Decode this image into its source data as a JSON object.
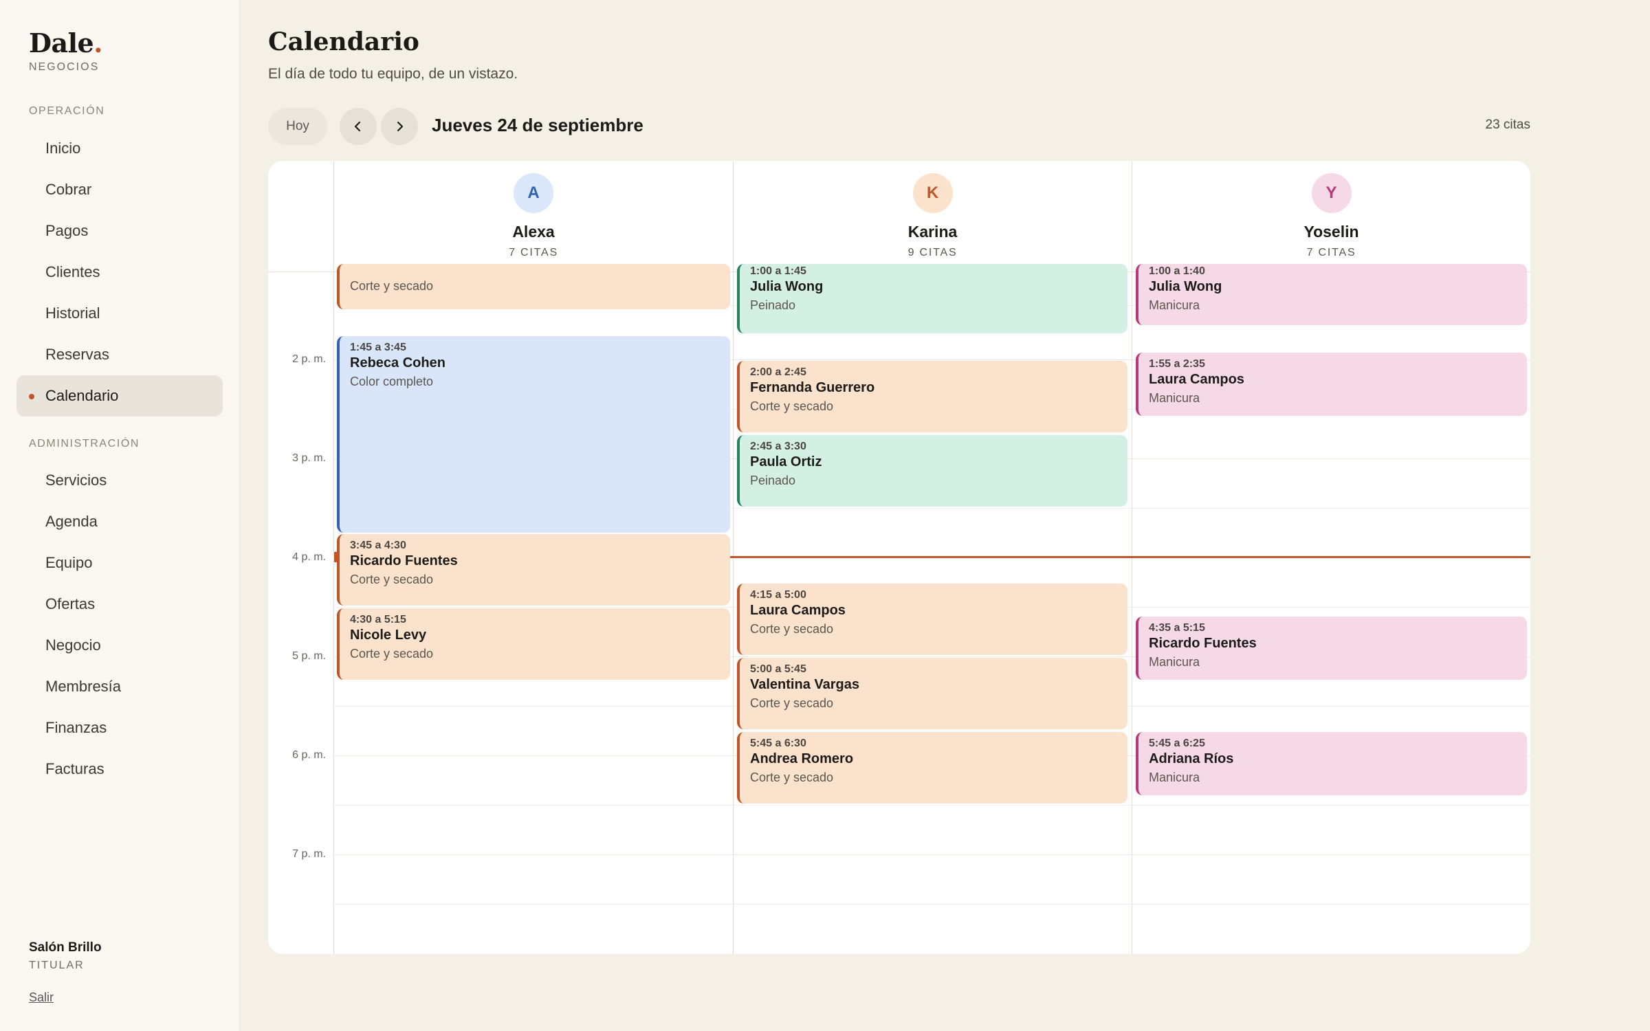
{
  "brand": {
    "name": "Dale",
    "dot": ".",
    "subtitle": "NEGOCIOS"
  },
  "sidebar": {
    "section_operacion": "OPERACIÓN",
    "section_admin": "ADMINISTRACIÓN",
    "operacion_items": [
      {
        "label": "Inicio"
      },
      {
        "label": "Cobrar"
      },
      {
        "label": "Pagos"
      },
      {
        "label": "Clientes"
      },
      {
        "label": "Historial"
      },
      {
        "label": "Reservas"
      },
      {
        "label": "Calendario",
        "active": true
      }
    ],
    "admin_items": [
      {
        "label": "Servicios"
      },
      {
        "label": "Agenda"
      },
      {
        "label": "Equipo"
      },
      {
        "label": "Ofertas"
      },
      {
        "label": "Negocio"
      },
      {
        "label": "Membresía"
      },
      {
        "label": "Finanzas"
      },
      {
        "label": "Facturas"
      }
    ],
    "owner_name": "Salón Brillo",
    "owner_role": "TITULAR",
    "logout": "Salir"
  },
  "page": {
    "title": "Calendario",
    "subtitle": "El día de todo tu equipo, de un vistazo."
  },
  "toolbar": {
    "today": "Hoy",
    "prev_icon": "chevron-left-icon",
    "next_icon": "chevron-right-icon",
    "date": "Jueves 24 de septiembre",
    "count": "23 citas"
  },
  "calendar": {
    "hours": [
      "2 p. m.",
      "3 p. m.",
      "4 p. m.",
      "5 p. m.",
      "6 p. m.",
      "7 p. m."
    ],
    "staff": [
      {
        "initial": "A",
        "name": "Alexa",
        "count": "7 CITAS",
        "avatar_bg": "#dbe7fb",
        "avatar_fg": "#2f62b4",
        "appointments": [
          {
            "time": "",
            "client": "",
            "service": "Corte y secado",
            "color": "orange",
            "cut": true
          },
          {
            "time": "1:45 a 3:45",
            "client": "Rebeca Cohen",
            "service": "Color completo",
            "color": "blue"
          },
          {
            "time": "3:45 a 4:30",
            "client": "Ricardo Fuentes",
            "service": "Corte y secado",
            "color": "orange"
          },
          {
            "time": "4:30 a 5:15",
            "client": "Nicole Levy",
            "service": "Corte y secado",
            "color": "orange"
          }
        ]
      },
      {
        "initial": "K",
        "name": "Karina",
        "count": "9 CITAS",
        "avatar_bg": "#fbe2cc",
        "avatar_fg": "#c0552a",
        "appointments": [
          {
            "time": "1:00 a 1:45",
            "client": "Julia Wong",
            "service": "Peinado",
            "color": "green",
            "cut": true
          },
          {
            "time": "2:00 a 2:45",
            "client": "Fernanda Guerrero",
            "service": "Corte y secado",
            "color": "orange"
          },
          {
            "time": "2:45 a 3:30",
            "client": "Paula Ortiz",
            "service": "Peinado",
            "color": "green"
          },
          {
            "time": "4:15 a 5:00",
            "client": "Laura Campos",
            "service": "Corte y secado",
            "color": "orange"
          },
          {
            "time": "5:00 a 5:45",
            "client": "Valentina Vargas",
            "service": "Corte y secado",
            "color": "orange"
          },
          {
            "time": "5:45 a 6:30",
            "client": "Andrea Romero",
            "service": "Corte y secado",
            "color": "orange"
          }
        ]
      },
      {
        "initial": "Y",
        "name": "Yoselin",
        "count": "7 CITAS",
        "avatar_bg": "#f6d9e6",
        "avatar_fg": "#b53a77",
        "appointments": [
          {
            "time": "1:00 a 1:40",
            "client": "Julia Wong",
            "service": "Manicura",
            "color": "pink",
            "cut": true
          },
          {
            "time": "1:55 a 2:35",
            "client": "Laura Campos",
            "service": "Manicura",
            "color": "pink"
          },
          {
            "time": "4:35 a 5:15",
            "client": "Ricardo Fuentes",
            "service": "Manicura",
            "color": "pink"
          },
          {
            "time": "5:45 a 6:25",
            "client": "Adriana Ríos",
            "service": "Manicura",
            "color": "pink"
          }
        ]
      }
    ]
  }
}
